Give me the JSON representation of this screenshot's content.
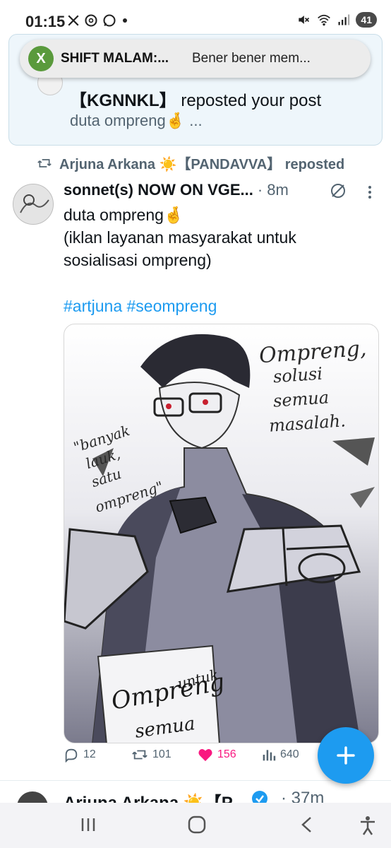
{
  "status_bar": {
    "time": "01:15",
    "battery": "41",
    "left_icons": [
      "x-icon",
      "threads-icon",
      "whatsapp-icon",
      "dot-icon"
    ],
    "right_icons": [
      "mute-icon",
      "wifi-icon",
      "signal-icon",
      "battery-icon"
    ]
  },
  "headsup": {
    "app_icon": "x-icon",
    "title": "SHIFT MALAM:...",
    "text": "Bener bener mem..."
  },
  "notification": {
    "user": "【KGNNKL】",
    "action": " reposted your post",
    "snippet": "duta ompreng🤞 ..."
  },
  "repost": {
    "label": "Arjuna Arkana ☀️【PANDAVVA】 reposted"
  },
  "tweet": {
    "author": "sonnet(s) NOW ON VGE...",
    "time": "8m",
    "lines": [
      "duta ompreng🤞",
      "(iklan layanan masyarakat untuk",
      "sosialisasi ompreng)"
    ],
    "hashtags": "#artjuna #seompreng",
    "image": {
      "text_top_right_1": "Ompreng,",
      "text_top_right_2": "solusi",
      "text_top_right_3": "semua",
      "text_top_right_4": "masalah.",
      "text_left_1": "\"banyak",
      "text_left_2": "lauk,",
      "text_left_3": "satu",
      "text_left_4": "ompreng\"",
      "text_bottom_1": "Ompreng",
      "text_bottom_2": "untuk",
      "text_bottom_3": "semua"
    },
    "stats": {
      "replies": "12",
      "reposts": "101",
      "likes": "156",
      "views": "640"
    }
  },
  "next_tweet": {
    "author": "Arjuna Arkana ☀️【P",
    "time": "· 37m"
  },
  "colors": {
    "accent": "#1d9bf0",
    "like": "#f91880",
    "muted": "#536471",
    "notif_bg": "#eef6fb"
  }
}
